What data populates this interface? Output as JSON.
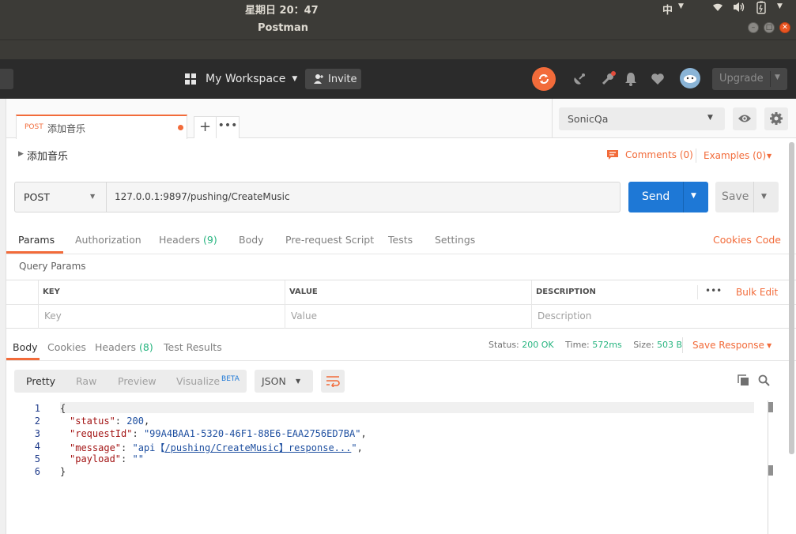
{
  "system": {
    "clock": "星期日 20：47",
    "input_method": "中"
  },
  "window": {
    "title": "Postman"
  },
  "toolbar": {
    "workspace": "My Workspace",
    "invite": "Invite",
    "upgrade": "Upgrade"
  },
  "request_tab": {
    "method": "POST",
    "name": "添加音乐"
  },
  "environment": {
    "selected": "SonicQa"
  },
  "request": {
    "name": "添加音乐",
    "comments": "Comments (0)",
    "examples": "Examples (0)",
    "method": "POST",
    "url": "127.0.0.1:9897/pushing/CreateMusic",
    "send": "Send",
    "save": "Save"
  },
  "req_tabs": {
    "params": "Params",
    "authorization": "Authorization",
    "headers": "Headers",
    "headers_count": "(9)",
    "body": "Body",
    "prerequest": "Pre-request Script",
    "tests": "Tests",
    "settings": "Settings",
    "cookies": "Cookies",
    "code": "Code"
  },
  "query_params": {
    "title": "Query Params",
    "headers": {
      "key": "KEY",
      "value": "VALUE",
      "description": "DESCRIPTION"
    },
    "bulk_edit": "Bulk Edit",
    "placeholders": {
      "key": "Key",
      "value": "Value",
      "description": "Description"
    }
  },
  "response": {
    "tabs": {
      "body": "Body",
      "cookies": "Cookies",
      "headers": "Headers",
      "headers_count": "(8)",
      "test_results": "Test Results"
    },
    "status_label": "Status:",
    "status": "200 OK",
    "time_label": "Time:",
    "time": "572ms",
    "size_label": "Size:",
    "size": "503 B",
    "save_response": "Save Response",
    "views": {
      "pretty": "Pretty",
      "raw": "Raw",
      "preview": "Preview",
      "visualize": "Visualize",
      "beta": "BETA"
    },
    "format": "JSON",
    "lines": [
      {
        "num": "1",
        "text": "{"
      },
      {
        "num": "2",
        "key": "\"status\"",
        "val": "200",
        "end": ","
      },
      {
        "num": "3",
        "key": "\"requestId\"",
        "val": "\"99A4BAA1-5320-46F1-88E6-EAA2756ED7BA\"",
        "end": ","
      },
      {
        "num": "4",
        "key": "\"message\"",
        "val_pre": "\"api【",
        "val_link": "/pushing/CreateMusic】response...",
        "val_post": "\"",
        "end": ","
      },
      {
        "num": "5",
        "key": "\"payload\"",
        "val": "\"\"",
        "end": ""
      },
      {
        "num": "6",
        "text": "}"
      }
    ]
  }
}
